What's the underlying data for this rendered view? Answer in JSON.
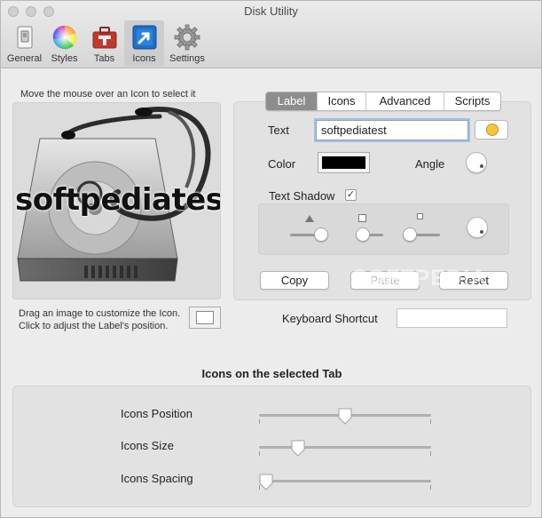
{
  "window": {
    "title": "Disk Utility"
  },
  "toolbar": {
    "items": [
      {
        "label": "General",
        "icon": "general-icon"
      },
      {
        "label": "Styles",
        "icon": "color-wheel-icon"
      },
      {
        "label": "Tabs",
        "icon": "tabs-toolbox-icon"
      },
      {
        "label": "Icons",
        "icon": "icons-arrow-icon",
        "active": true
      },
      {
        "label": "Settings",
        "icon": "gear-icon"
      }
    ]
  },
  "icon_preview": {
    "hint_top": "Move the mouse over an Icon to select it",
    "label_text": "softpediatest",
    "hint_bottom_line1": "Drag an image to customize the Icon.",
    "hint_bottom_line2": "Click to adjust the Label's position."
  },
  "label_panel": {
    "tabs": [
      "Label",
      "Icons",
      "Advanced",
      "Scripts"
    ],
    "selected_tab": "Label",
    "text_label": "Text",
    "text_value": "softpediatest",
    "color_label": "Color",
    "color_value": "#000000",
    "angle_label": "Angle",
    "text_shadow_label": "Text Shadow",
    "text_shadow_checked": true,
    "copy_button": "Copy",
    "paste_button": "Paste",
    "reset_button": "Reset"
  },
  "shortcut": {
    "label": "Keyboard Shortcut",
    "value": ""
  },
  "tab_icons": {
    "title": "Icons on the selected Tab",
    "position_label": "Icons Position",
    "position_value": 0.5,
    "size_label": "Icons Size",
    "size_value": 0.2,
    "spacing_label": "Icons Spacing",
    "spacing_value": 0.0
  },
  "watermark": "SOFTPEDIA",
  "colors": {
    "accent_focus": "#9cc3ee",
    "selected_segment": "#8d8d8d"
  }
}
